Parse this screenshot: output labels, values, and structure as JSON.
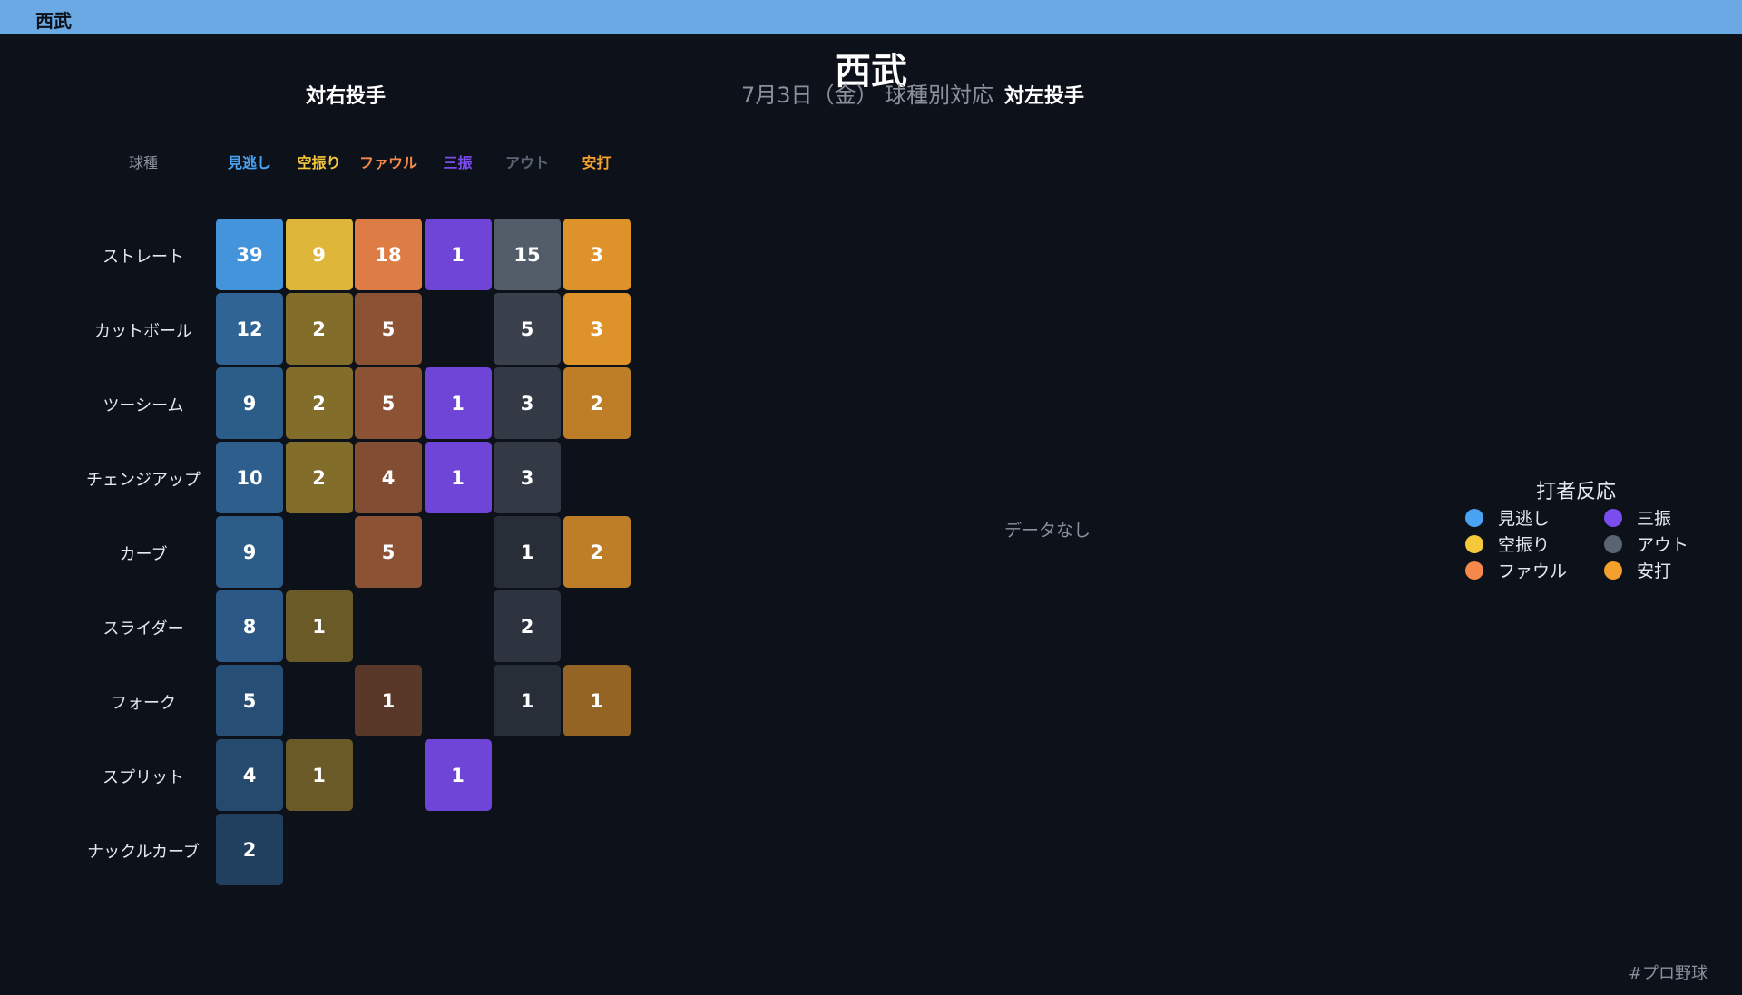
{
  "header": {
    "title": "西武"
  },
  "chart_title": "西武",
  "subtitle": "7月3日（金） 球種別対応",
  "footer_tag": "#プロ野球",
  "chart_data": {
    "type": "heatmap",
    "panels": [
      {
        "title": "対右投手",
        "corner_label": "球種",
        "columns": [
          {
            "key": "minogashi",
            "label": "見逃し",
            "color": "#4aa3f2"
          },
          {
            "key": "karaburi",
            "label": "空振り",
            "color": "#f5c83c"
          },
          {
            "key": "foul",
            "label": "ファウル",
            "color": "#f5884a"
          },
          {
            "key": "sanshin",
            "label": "三振",
            "color": "#7b4cf0"
          },
          {
            "key": "out",
            "label": "アウト",
            "color": "#5b6472"
          },
          {
            "key": "anda",
            "label": "安打",
            "color": "#f5a02c"
          }
        ],
        "rows": [
          {
            "label": "ストレート",
            "values": [
              39,
              9,
              18,
              1,
              15,
              3
            ]
          },
          {
            "label": "カットボール",
            "values": [
              12,
              2,
              5,
              null,
              5,
              3
            ]
          },
          {
            "label": "ツーシーム",
            "values": [
              9,
              2,
              5,
              1,
              3,
              2
            ]
          },
          {
            "label": "チェンジアップ",
            "values": [
              10,
              2,
              4,
              1,
              3,
              null
            ]
          },
          {
            "label": "カーブ",
            "values": [
              9,
              null,
              5,
              null,
              1,
              2
            ]
          },
          {
            "label": "スライダー",
            "values": [
              8,
              1,
              null,
              null,
              2,
              null
            ]
          },
          {
            "label": "フォーク",
            "values": [
              5,
              null,
              1,
              null,
              1,
              1
            ]
          },
          {
            "label": "スプリット",
            "values": [
              4,
              1,
              null,
              1,
              null,
              null
            ]
          },
          {
            "label": "ナックルカーブ",
            "values": [
              2,
              null,
              null,
              null,
              null,
              null
            ]
          }
        ]
      },
      {
        "title": "対左投手",
        "empty_text": "データなし",
        "rows": []
      }
    ],
    "legend": {
      "title": "打者反応",
      "items": [
        {
          "label": "見逃し",
          "color": "#4aa3f2"
        },
        {
          "label": "三振",
          "color": "#7b4cf0"
        },
        {
          "label": "空振り",
          "color": "#f5c83c"
        },
        {
          "label": "アウト",
          "color": "#5b6472"
        },
        {
          "label": "ファウル",
          "color": "#f5884a"
        },
        {
          "label": "安打",
          "color": "#f5a02c"
        }
      ]
    }
  }
}
